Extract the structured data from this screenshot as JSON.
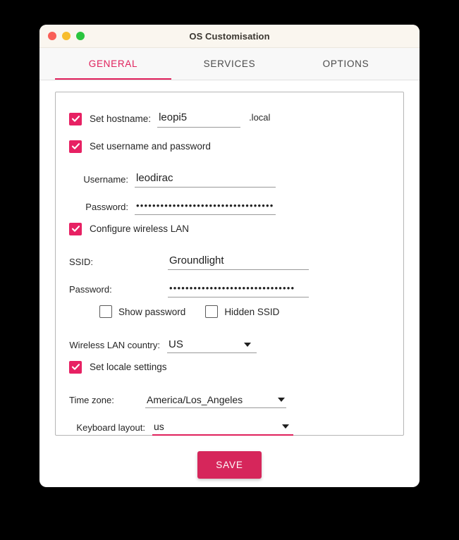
{
  "window": {
    "title": "OS Customisation",
    "traffic_lights": [
      {
        "name": "close",
        "color": "#f95f57"
      },
      {
        "name": "minimize",
        "color": "#f7bd2e"
      },
      {
        "name": "maximize",
        "color": "#2ac53f"
      }
    ]
  },
  "tabs": [
    {
      "label": "GENERAL",
      "active": true
    },
    {
      "label": "SERVICES",
      "active": false
    },
    {
      "label": "OPTIONS",
      "active": false
    }
  ],
  "accent": {
    "primary": "#e0215c",
    "checkbox": "#e72163",
    "save_button": "#d6265b"
  },
  "form": {
    "hostname": {
      "checkbox_label": "Set hostname:",
      "checked": true,
      "value": "leopi5",
      "suffix": ".local"
    },
    "user": {
      "checkbox_label": "Set username and password",
      "checked": true,
      "username_label": "Username:",
      "username_value": "leodirac",
      "password_label": "Password:",
      "password_masked": "••••••••••••••••••••••••••••••••••"
    },
    "wireless": {
      "checkbox_label": "Configure wireless LAN",
      "checked": true,
      "ssid_label": "SSID:",
      "ssid_value": "Groundlight",
      "password_label": "Password:",
      "password_masked": "•••••••••••••••••••••••••••••••",
      "show_password_label": "Show password",
      "show_password_checked": false,
      "hidden_ssid_label": "Hidden SSID",
      "hidden_ssid_checked": false,
      "country_label": "Wireless LAN country:",
      "country_value": "US"
    },
    "locale": {
      "checkbox_label": "Set locale settings",
      "checked": true,
      "timezone_label": "Time zone:",
      "timezone_value": "America/Los_Angeles",
      "keyboard_label": "Keyboard layout:",
      "keyboard_value": "us",
      "keyboard_focused": true
    }
  },
  "footer": {
    "save_label": "SAVE"
  }
}
